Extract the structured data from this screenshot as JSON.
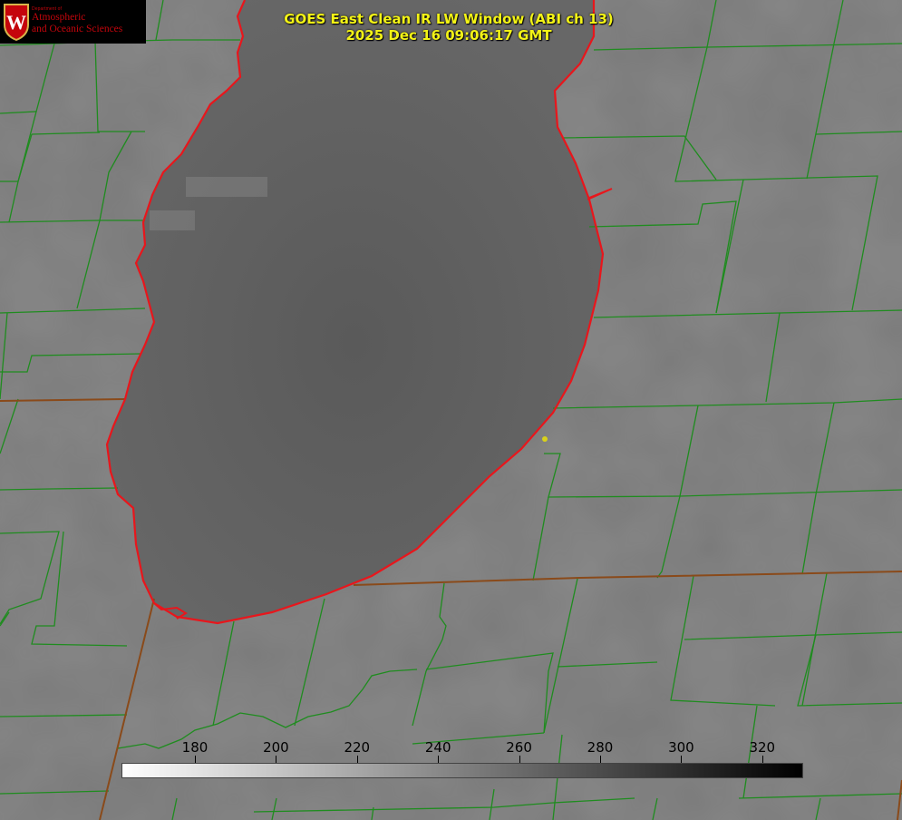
{
  "header": {
    "title": "GOES East Clean IR LW Window (ABI ch 13)",
    "timestamp": "2025 Dec 16 09:06:17 GMT"
  },
  "logo": {
    "dept_line": "Department of",
    "line1": "Atmospheric",
    "line2": "and Oceanic Sciences",
    "crest_letter": "W"
  },
  "colorbar": {
    "ticks": [
      "180",
      "200",
      "220",
      "240",
      "260",
      "280",
      "300",
      "320"
    ],
    "gradient": [
      "#ffffff",
      "#000000"
    ]
  },
  "colors": {
    "coastline": "#e8161c",
    "county_lines": "#1f8c1f",
    "title": "#f3f316",
    "land": "#7c7c7c",
    "lake": "#5e5e5e",
    "station": "#d9d21a"
  }
}
